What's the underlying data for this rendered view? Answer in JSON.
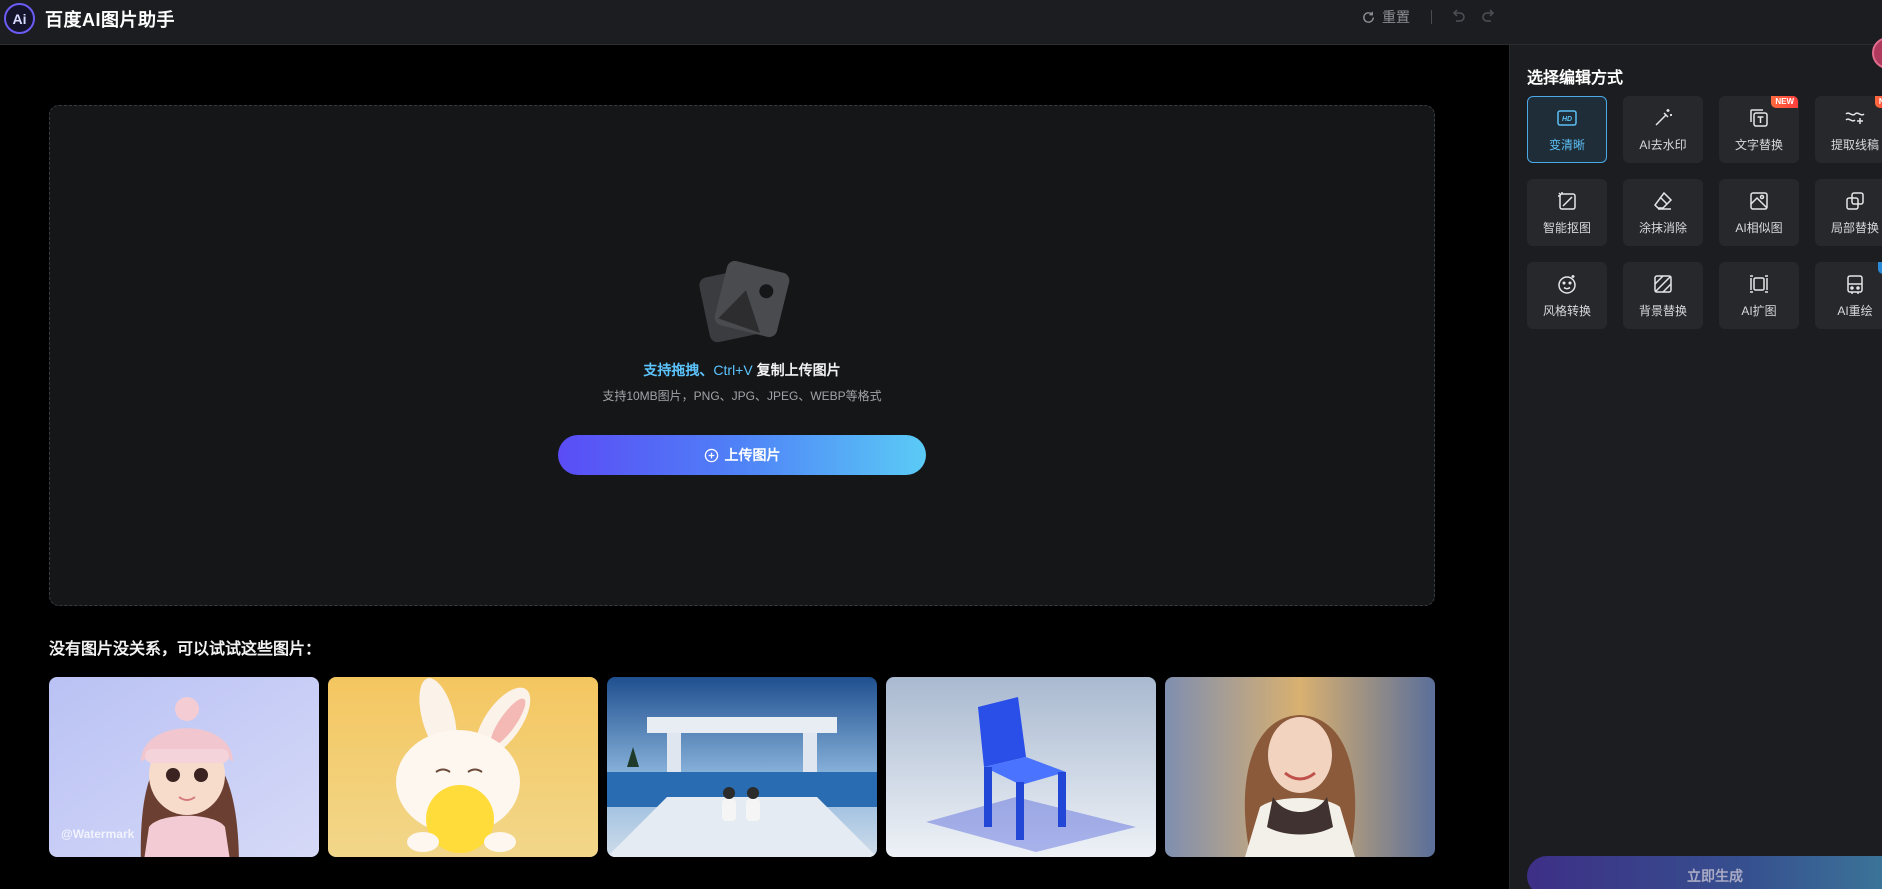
{
  "header": {
    "logo_text": "Ai",
    "app_title": "百度AI图片助手",
    "reset_label": "重置"
  },
  "dropzone": {
    "hint_highlight": "支持拖拽、",
    "hint_shortcut": "Ctrl+V",
    "hint_rest": " 复制上传图片",
    "formats": "支持10MB图片，PNG、JPG、JPEG、WEBP等格式",
    "upload_label": "上传图片"
  },
  "samples": {
    "title": "没有图片没关系，可以试试这些图片：",
    "watermark": "@Watermark"
  },
  "panel": {
    "title": "选择编辑方式",
    "tools": [
      {
        "label": "变清晰",
        "icon": "hd-icon",
        "active": true
      },
      {
        "label": "AI去水印",
        "icon": "magic-wand-icon",
        "badge": ""
      },
      {
        "label": "文字替换",
        "icon": "text-replace-icon",
        "badge": "NEW"
      },
      {
        "label": "提取线稿",
        "icon": "line-art-icon",
        "badge": "NE"
      },
      {
        "label": "智能抠图",
        "icon": "cutout-icon"
      },
      {
        "label": "涂抹消除",
        "icon": "eraser-icon"
      },
      {
        "label": "AI相似图",
        "icon": "similar-image-icon"
      },
      {
        "label": "局部替换",
        "icon": "partial-replace-icon"
      },
      {
        "label": "风格转换",
        "icon": "style-icon"
      },
      {
        "label": "背景替换",
        "icon": "background-icon"
      },
      {
        "label": "AI扩图",
        "icon": "expand-icon"
      },
      {
        "label": "AI重绘",
        "icon": "redraw-icon",
        "badge": "Pr"
      }
    ],
    "generate_label": "立即生成"
  },
  "colors": {
    "accent": "#5cc5ff",
    "brand_gradient_start": "#5a4cf6",
    "brand_gradient_end": "#5bcbf6",
    "new_badge": "#ff4a3d"
  }
}
